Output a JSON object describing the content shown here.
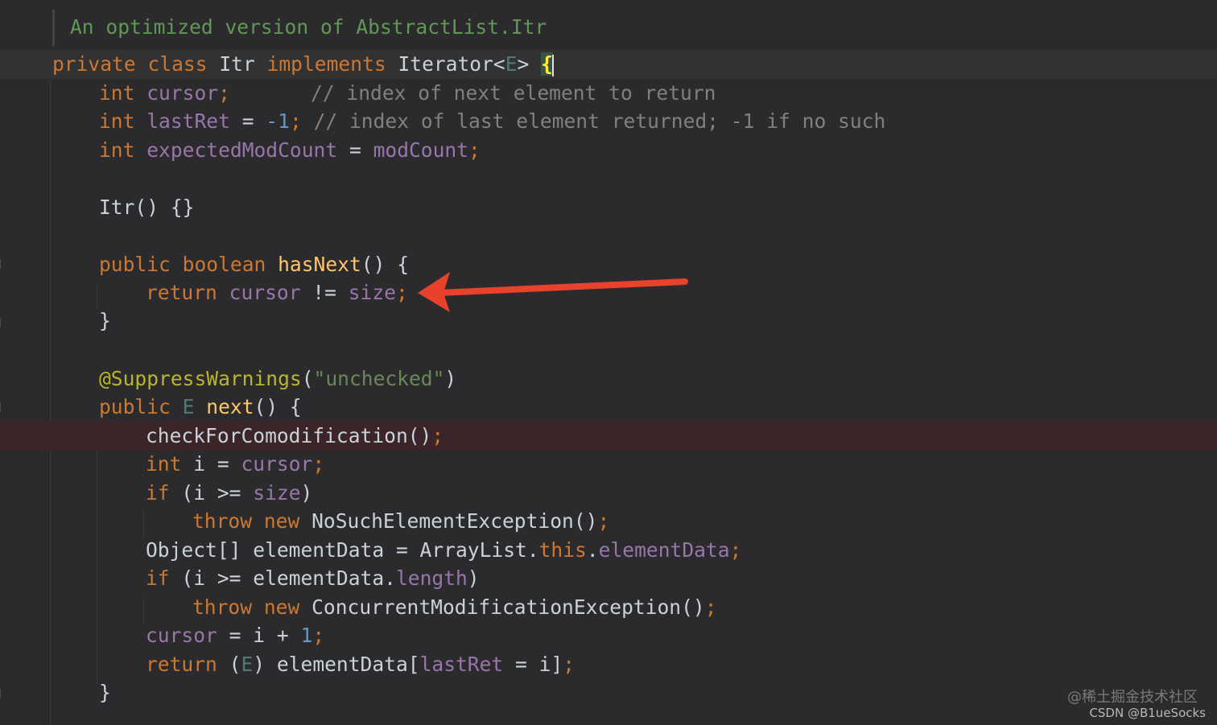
{
  "editor": {
    "doc_comment": "An optimized version of AbstractList.Itr",
    "class_decl": {
      "private": "private",
      "class": "class",
      "name": "Itr",
      "implements": "implements",
      "iface": "Iterator<",
      "type_param": "E",
      "iface_close": "> ",
      "open_brace": "{"
    },
    "field_cursor": {
      "type": "int",
      "name": "cursor",
      "semi": ";",
      "comment": "// index of next element to return"
    },
    "field_lastret": {
      "type": "int",
      "name": "lastRet",
      "eq": " = ",
      "value": "-1",
      "semi": ";",
      "comment": "// index of last element returned; -1 if no such"
    },
    "field_emc": {
      "type": "int",
      "name": "expectedModCount",
      "eq": " = ",
      "value": "modCount",
      "semi": ";"
    },
    "ctor": "Itr() {}",
    "hasnext_decl": {
      "public": "public",
      "boolean": "boolean",
      "name": "hasNext",
      "rest": "() {"
    },
    "hasnext_body": {
      "return": "return",
      "cursor": "cursor",
      "op": " != ",
      "size": "size",
      "semi": ";"
    },
    "close_brace": "}",
    "annotation": {
      "name": "@SuppressWarnings",
      "open": "(",
      "value": "\"unchecked\"",
      "close": ")"
    },
    "next_decl": {
      "public": "public",
      "type_param": "E",
      "name": "next",
      "rest": "() {"
    },
    "next_l1": {
      "call": "checkForComodification()",
      "semi": ";"
    },
    "next_l2": {
      "type": "int",
      "mid": " i = ",
      "cursor": "cursor",
      "semi": ";"
    },
    "next_l3": {
      "if": "if",
      "open": " (i >= ",
      "size": "size",
      "close": ")"
    },
    "next_l4": {
      "throw": "throw",
      "new": "new",
      "exc": "NoSuchElementException()",
      "semi": ";"
    },
    "next_l5": {
      "a": "Object[] elementData = ArrayList.",
      "this": "this",
      "dot": ".",
      "field": "elementData",
      "semi": ";"
    },
    "next_l6": {
      "if": "if",
      "open": " (i >= elementData.",
      "length": "length",
      "close": ")"
    },
    "next_l7": {
      "throw": "throw",
      "new": "new",
      "exc": "ConcurrentModificationException()",
      "semi": ";"
    },
    "next_l8": {
      "cursor": "cursor",
      "mid": " = i + ",
      "one": "1",
      "semi": ";"
    },
    "next_l9": {
      "return": "return",
      "open": " (",
      "type_param": "E",
      "mid": ") elementData[",
      "lastret": "lastRet",
      "end": " = i]",
      "semi": ";"
    }
  },
  "annotation_arrow": {
    "color": "#e8412c"
  },
  "watermark": {
    "line1": "@稀土掘金技术社区",
    "line2": "CSDN @B1ueSocks"
  }
}
